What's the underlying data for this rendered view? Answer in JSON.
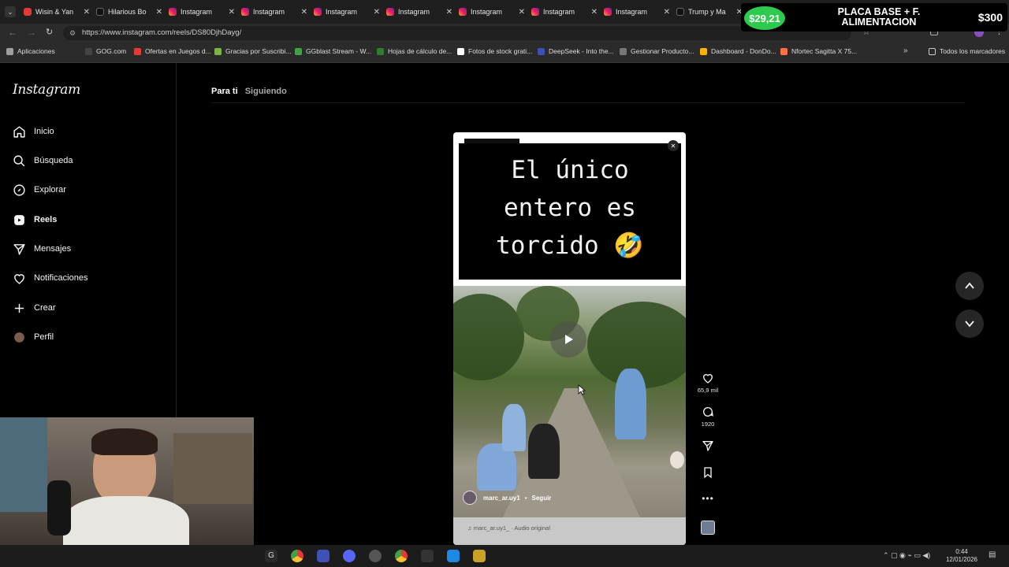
{
  "browser": {
    "tabs": [
      {
        "title": "Wisin & Yan",
        "icon": "youtube-icon"
      },
      {
        "title": "Hilarious Bo",
        "icon": "tiktok-icon"
      },
      {
        "title": "Instagram",
        "icon": "instagram-icon"
      },
      {
        "title": "Instagram",
        "icon": "instagram-icon"
      },
      {
        "title": "Instagram",
        "icon": "instagram-icon"
      },
      {
        "title": "Instagram",
        "icon": "instagram-icon"
      },
      {
        "title": "Instagram",
        "icon": "instagram-icon"
      },
      {
        "title": "Instagram",
        "icon": "instagram-icon"
      },
      {
        "title": "Instagram",
        "icon": "instagram-icon"
      },
      {
        "title": "Trump y Ma",
        "icon": "tiktok-icon"
      },
      {
        "title": "Instagram",
        "icon": "instagram-icon"
      }
    ],
    "url": "https://www.instagram.com/reels/DS80DjhDayg/",
    "bookmarks": [
      "Aplicaciones",
      "GOG.com",
      "Ofertas en Juegos d...",
      "Gracias por Suscribi...",
      "GGblast Stream - W...",
      "Hojas de cálculo de...",
      "Fotos de stock grati...",
      "DeepSeek - Into the...",
      "Gestionar Producto...",
      "Dashboard - DonDo...",
      "Nfortec Sagitta X 75..."
    ],
    "bookmarks_all": "Todos los marcadores"
  },
  "sidebar": {
    "logo": "Instagram",
    "items": [
      {
        "label": "Inicio",
        "icon": "home-icon"
      },
      {
        "label": "Búsqueda",
        "icon": "search-icon"
      },
      {
        "label": "Explorar",
        "icon": "compass-icon"
      },
      {
        "label": "Reels",
        "icon": "reels-icon",
        "active": true
      },
      {
        "label": "Mensajes",
        "icon": "send-icon"
      },
      {
        "label": "Notificaciones",
        "icon": "heart-icon"
      },
      {
        "label": "Crear",
        "icon": "plus-icon"
      },
      {
        "label": "Perfil",
        "icon": "avatar-icon"
      }
    ]
  },
  "feed_tabs": {
    "active": "Para ti",
    "other": "Siguiendo"
  },
  "reel": {
    "caption_lines": [
      "El único",
      "entero es",
      "torcido 🤣"
    ],
    "username": "marc_ar.uy1",
    "follow_label": "Seguir",
    "audio_label": "marc_ar.uy1_ · Audio original"
  },
  "actions": {
    "likes": "65,9 mil",
    "comments": "1920"
  },
  "overlay": {
    "price_left": "$29,21",
    "banner_text": "PLACA BASE + F. ALIMENTACION",
    "price_right": "$300"
  },
  "taskbar": {
    "time": "0:44",
    "date": "12/01/2026"
  },
  "colors": {
    "background": "#000000",
    "accent_green": "#2ec94f"
  }
}
